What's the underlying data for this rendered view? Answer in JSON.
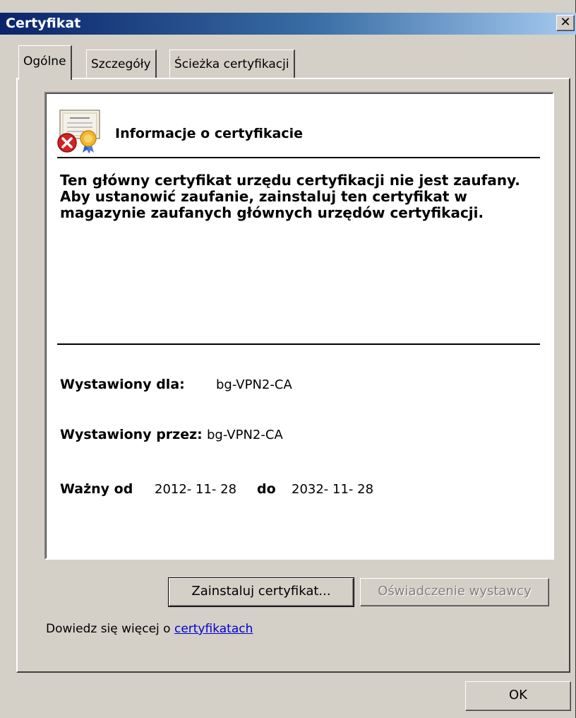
{
  "window": {
    "title": "Certyfikat",
    "close_label": "✕"
  },
  "tabs": [
    {
      "label": "Ogólne",
      "active": true
    },
    {
      "label": "Szczegóły",
      "active": false
    },
    {
      "label": "Ścieżka certyfikacji",
      "active": false
    }
  ],
  "info": {
    "title": "Informacje o certyfikacie",
    "message": "Ten główny certyfikat urzędu certyfikacji nie jest zaufany. Aby ustanowić zaufanie, zainstaluj ten certyfikat w magazynie zaufanych głównych urzędów certyfikacji.",
    "issued_to_label": "Wystawiony dla:",
    "issued_to_value": "bg-VPN2-CA",
    "issued_by_label": "Wystawiony przez:",
    "issued_by_value": "bg-VPN2-CA",
    "valid_from_label": "Ważny od",
    "valid_from_value": "2012- 11- 28",
    "valid_to_label": "do",
    "valid_to_value": "2032- 11- 28"
  },
  "buttons": {
    "install": "Zainstaluj certyfikat...",
    "issuer_statement": "Oświadczenie wystawcy",
    "ok": "OK"
  },
  "learn_more": {
    "prefix": "Dowiedz się więcej o ",
    "link": "certyfikatach"
  },
  "icons": {
    "cert": "certificate-error-icon"
  },
  "colors": {
    "titlebar_start": "#0a246a",
    "titlebar_end": "#a6caf0",
    "link": "#0000cc",
    "error": "#d62020"
  }
}
